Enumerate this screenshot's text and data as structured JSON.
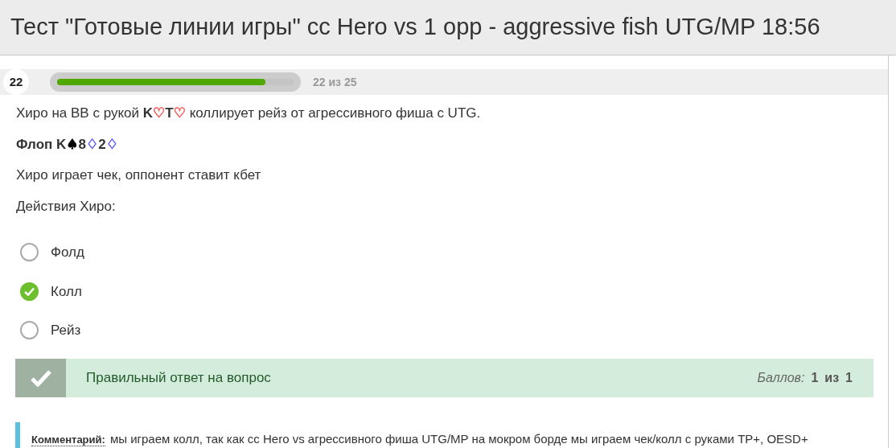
{
  "title": "Тест \"Готовые линии игры\" сс Hero vs 1 opp - aggressive fish UTG/MP 18:56",
  "progress": {
    "number": "22",
    "level": 0.88,
    "label": "22 из 25"
  },
  "question": [
    {
      "segments": [
        {
          "kind": "text",
          "text": "Хиро на BB с рукой "
        },
        {
          "kind": "bold",
          "text": "K"
        },
        {
          "kind": "suit",
          "text": "♡",
          "color": "#ff5050"
        },
        {
          "kind": "bold",
          "text": "T"
        },
        {
          "kind": "suit",
          "text": "♡",
          "color": "#ff5050"
        },
        {
          "kind": "text",
          "text": " коллирует рейз от агрессивного фиша с UTG."
        }
      ]
    },
    {
      "segments": [
        {
          "kind": "bold",
          "text": "Флоп K"
        },
        {
          "kind": "suit",
          "text": "♠",
          "color": "#000000"
        },
        {
          "kind": "bold",
          "text": "8"
        },
        {
          "kind": "suit",
          "text": "♢",
          "color": "#5555ff"
        },
        {
          "kind": "bold",
          "text": "2"
        },
        {
          "kind": "suit",
          "text": "♢",
          "color": "#5555ff"
        }
      ]
    },
    {
      "segments": [
        {
          "kind": "text",
          "text": "Хиро играет чек, оппонент ставит кбет"
        }
      ]
    },
    {
      "segments": [
        {
          "kind": "text",
          "text": "Действия Хиро:"
        }
      ]
    }
  ],
  "options": [
    {
      "label": "Фолд",
      "selected": false
    },
    {
      "label": "Колл",
      "selected": true
    },
    {
      "label": "Рейз",
      "selected": false
    }
  ],
  "result": {
    "message": "Правильный ответ на вопрос",
    "score_label": "Баллов:",
    "score": "1",
    "of": "из",
    "total": "1"
  },
  "comment": {
    "label": "Комментарий:",
    "text": "мы играем колл, так как сс Hero vs агрессивного фиша UTG/MP на мокром борде мы играем чек/колл с руками TP+, OESD+"
  }
}
